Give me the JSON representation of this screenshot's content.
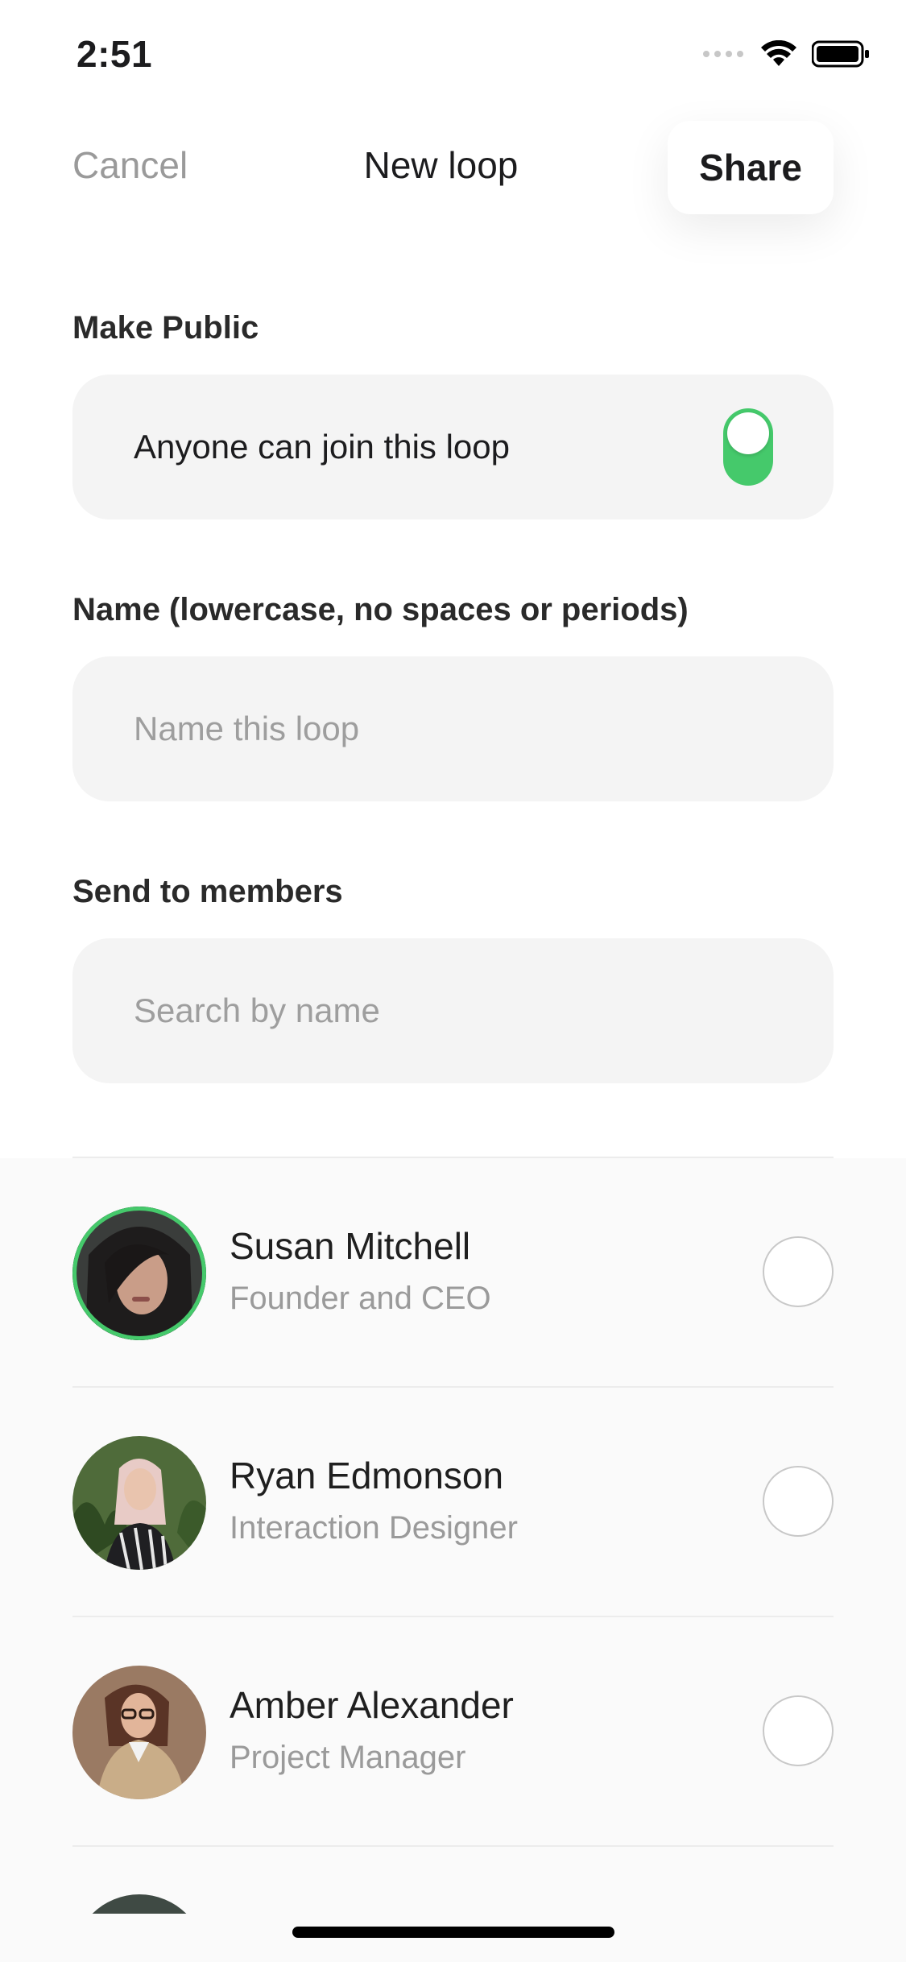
{
  "status": {
    "time": "2:51"
  },
  "nav": {
    "cancel_label": "Cancel",
    "title": "New loop",
    "share_label": "Share"
  },
  "make_public": {
    "label": "Make Public",
    "text": "Anyone can join this loop",
    "toggle_on": true,
    "toggle_color": "#45c96b"
  },
  "name_field": {
    "label": "Name (lowercase, no spaces or periods)",
    "placeholder": "Name this loop",
    "value": ""
  },
  "members_section": {
    "label": "Send to members",
    "search_placeholder": "Search by name"
  },
  "members": [
    {
      "name": "Susan Mitchell",
      "role": "Founder and CEO",
      "avatar": "woman-dark-hair-photo",
      "highlighted": true,
      "checked": false
    },
    {
      "name": "Ryan Edmonson",
      "role": "Interaction Designer",
      "avatar": "woman-pink-hair-photo",
      "highlighted": false,
      "checked": false
    },
    {
      "name": "Amber Alexander",
      "role": "Project Manager",
      "avatar": "woman-glasses-photo",
      "highlighted": false,
      "checked": false
    }
  ],
  "accent_color": "#45c96b"
}
